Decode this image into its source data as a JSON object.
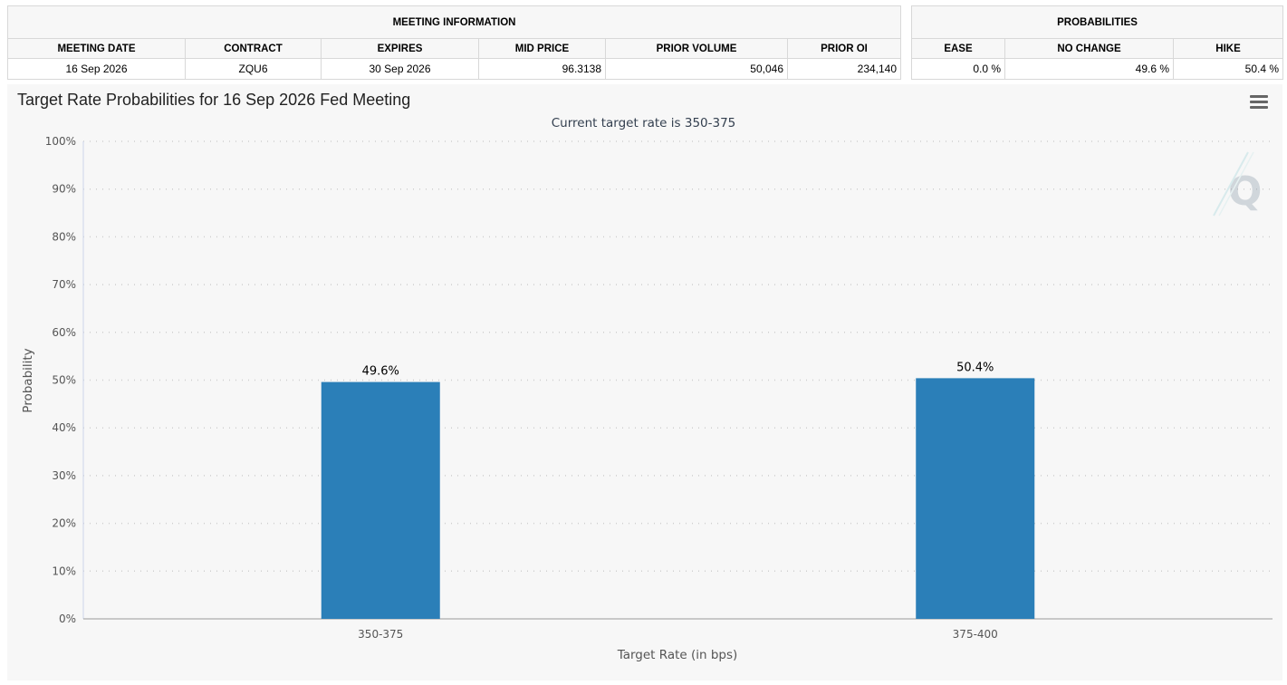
{
  "meeting_info": {
    "title": "MEETING INFORMATION",
    "headers": [
      "MEETING DATE",
      "CONTRACT",
      "EXPIRES",
      "MID PRICE",
      "PRIOR VOLUME",
      "PRIOR OI"
    ],
    "row": [
      "16 Sep 2026",
      "ZQU6",
      "30 Sep 2026",
      "96.3138",
      "50,046",
      "234,140"
    ]
  },
  "probabilities": {
    "title": "PROBABILITIES",
    "headers": [
      "EASE",
      "NO CHANGE",
      "HIKE"
    ],
    "row": [
      "0.0 %",
      "49.6 %",
      "50.4 %"
    ]
  },
  "menu_icon": "hamburger-menu-icon",
  "watermark_icon": "q-logo-icon",
  "chart_data": {
    "type": "bar",
    "title": "Target Rate Probabilities for 16 Sep 2026 Fed Meeting",
    "subtitle": "Current target rate is 350-375",
    "xlabel": "Target Rate (in bps)",
    "ylabel": "Probability",
    "categories": [
      "350-375",
      "375-400"
    ],
    "values": [
      49.6,
      50.4
    ],
    "data_labels": [
      "49.6%",
      "50.4%"
    ],
    "ylim": [
      0,
      100
    ],
    "yticks": [
      0,
      10,
      20,
      30,
      40,
      50,
      60,
      70,
      80,
      90,
      100
    ],
    "ytick_labels": [
      "0%",
      "10%",
      "20%",
      "30%",
      "40%",
      "50%",
      "60%",
      "70%",
      "80%",
      "90%",
      "100%"
    ],
    "grid": true,
    "legend": "none",
    "bar_color": "#2b7fb8"
  }
}
